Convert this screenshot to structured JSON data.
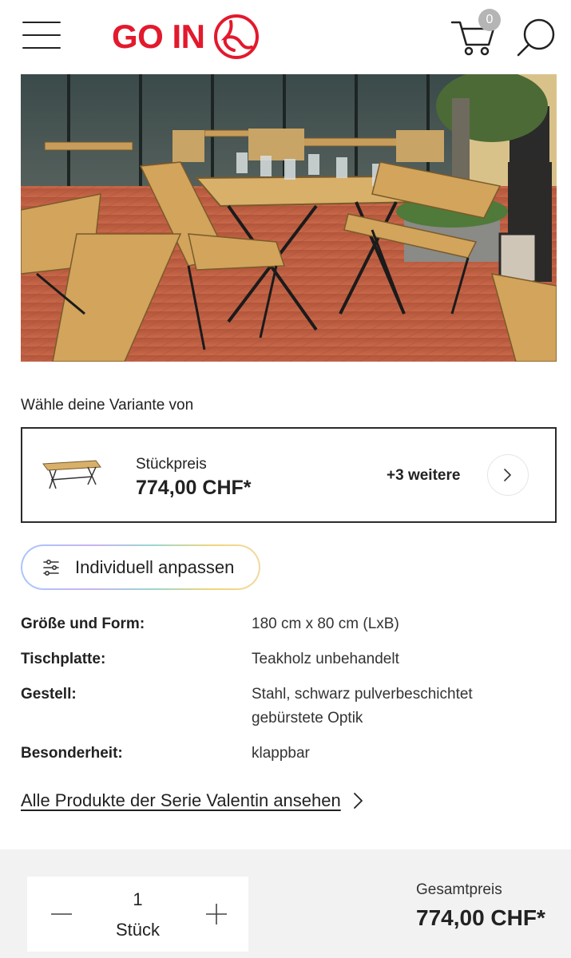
{
  "header": {
    "logo_text": "GO IN",
    "cart_count": "0",
    "colors": {
      "brand": "#e3192d",
      "badge": "#b5b5b5"
    }
  },
  "hero": {
    "image_alt_icon": "product-photo"
  },
  "variant": {
    "heading": "Wähle deine Variante von",
    "unit_label": "Stückpreis",
    "unit_price": "774,00 CHF*",
    "more": "+3 weitere"
  },
  "customize": {
    "label": "Individuell anpassen"
  },
  "specs": [
    {
      "key": "Größe und Form:",
      "value": "180 cm x 80 cm (LxB)"
    },
    {
      "key": "Tischplatte:",
      "value": "Teakholz unbehandelt"
    },
    {
      "key": "Gestell:",
      "value": "Stahl, schwarz pulverbeschichtet",
      "value2": "gebürstete Optik"
    },
    {
      "key": "Besonderheit:",
      "value": "klappbar"
    }
  ],
  "series_link": "Alle Produkte der Serie Valentin ansehen",
  "bottom": {
    "quantity": "1",
    "unit": "Stück",
    "total_label": "Gesamtpreis",
    "total_price": "774,00 CHF*"
  }
}
